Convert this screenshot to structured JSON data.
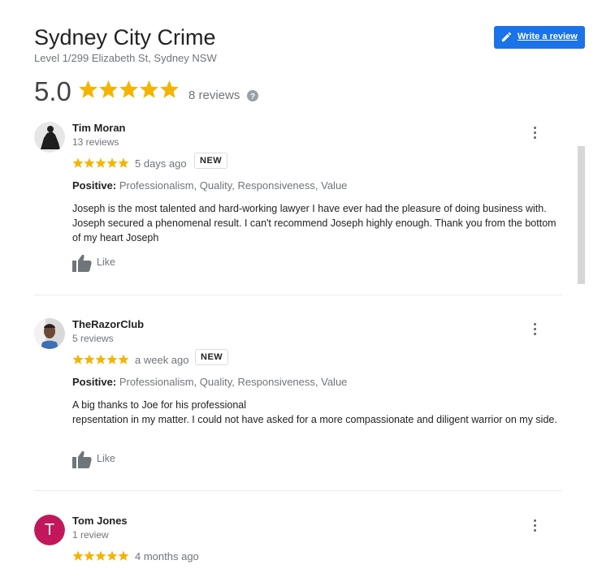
{
  "header": {
    "title": "Sydney City Crime",
    "address": "Level 1/299 Elizabeth St, Sydney NSW",
    "write_review_label": "Write a review",
    "rating": "5.0",
    "review_count": "8 reviews",
    "star_rating": 5
  },
  "colors": {
    "star": "#f4b400",
    "accent": "#1a73e8",
    "avatar_t": "#c2185b"
  },
  "reviews": [
    {
      "name": "Tim Moran",
      "count": "13 reviews",
      "stars": 5,
      "time": "5 days ago",
      "badge": "NEW",
      "positive_label": "Positive:",
      "positive_values": "Professionalism, Quality, Responsiveness, Value",
      "text": "Joseph is the most talented and hard-working lawyer I have ever had the pleasure of doing business with.  Joseph secured a phenomenal result. I can't recommend Joseph highly enough. Thank you from the bottom of my heart Joseph",
      "like_label": "Like"
    },
    {
      "name": "TheRazorClub",
      "count": "5 reviews",
      "stars": 5,
      "time": "a week ago",
      "badge": "NEW",
      "positive_label": "Positive:",
      "positive_values": "Professionalism, Quality, Responsiveness, Value",
      "text": "A big thanks to Joe for his professional\nrepsentation in my matter. I could  not have asked for a more compassionate and diligent warrior on my side.",
      "like_label": "Like"
    },
    {
      "name": "Tom Jones",
      "count": "1 review",
      "stars": 5,
      "time": "4 months ago",
      "avatar_letter": "T"
    }
  ]
}
